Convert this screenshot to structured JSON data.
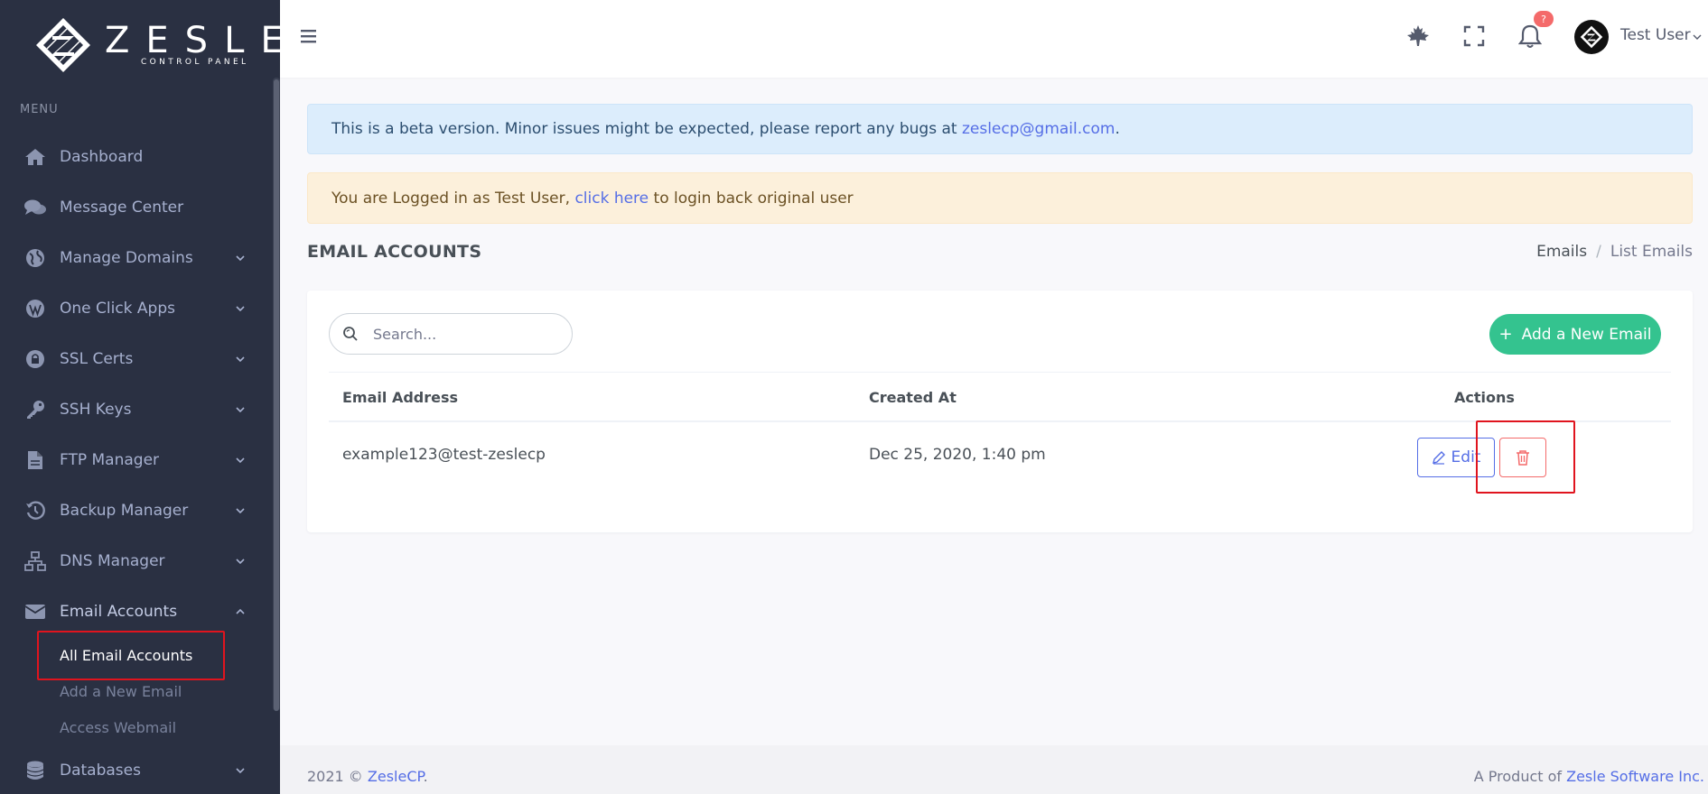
{
  "brand": {
    "name": "ZESLE",
    "tagline": "CONTROL PANEL"
  },
  "sidebar": {
    "menu_title": "MENU",
    "items": [
      {
        "label": "Dashboard",
        "icon": "home-icon"
      },
      {
        "label": "Message Center",
        "icon": "chat-icon"
      },
      {
        "label": "Manage Domains",
        "icon": "globe-icon"
      },
      {
        "label": "One Click Apps",
        "icon": "wordpress-icon"
      },
      {
        "label": "SSL Certs",
        "icon": "lock-icon"
      },
      {
        "label": "SSH Keys",
        "icon": "key-icon"
      },
      {
        "label": "FTP Manager",
        "icon": "file-icon"
      },
      {
        "label": "Backup Manager",
        "icon": "history-icon"
      },
      {
        "label": "DNS Manager",
        "icon": "sitemap-icon"
      },
      {
        "label": "Email Accounts",
        "icon": "envelope-icon"
      },
      {
        "label": "Databases",
        "icon": "database-icon"
      }
    ],
    "email_sub": [
      {
        "label": "All Email Accounts"
      },
      {
        "label": "Add a New Email"
      },
      {
        "label": "Access Webmail"
      }
    ]
  },
  "topbar": {
    "notification_count": "?",
    "username": "Test User"
  },
  "alerts": {
    "beta_text": "This is a beta version. Minor issues might be expected, please report any bugs at ",
    "beta_email": "zeslecp@gmail.com",
    "beta_end": ".",
    "login_pre": "You are Logged in as Test User, ",
    "login_link": "click here",
    "login_post": " to login back original user"
  },
  "page": {
    "title": "EMAIL ACCOUNTS",
    "breadcrumb": [
      "Emails",
      "List Emails"
    ]
  },
  "table": {
    "search_placeholder": "Search...",
    "add_button": "Add a New Email",
    "columns": [
      "Email Address",
      "Created At",
      "Actions"
    ],
    "rows": [
      {
        "email": "example123@test-zeslecp",
        "created": "Dec 25, 2020, 1:40 pm",
        "edit_label": "Edit"
      }
    ]
  },
  "footer": {
    "year": "2021 © ",
    "link": "ZesleCP",
    "dot": ".",
    "right_pre": "A Product of ",
    "right_link": "Zesle Software Inc."
  },
  "colors": {
    "sidebar": "#2a3042",
    "accent": "#556ee6",
    "success": "#34c38f",
    "danger": "#f46a6a",
    "highlight": "#e0141e"
  }
}
